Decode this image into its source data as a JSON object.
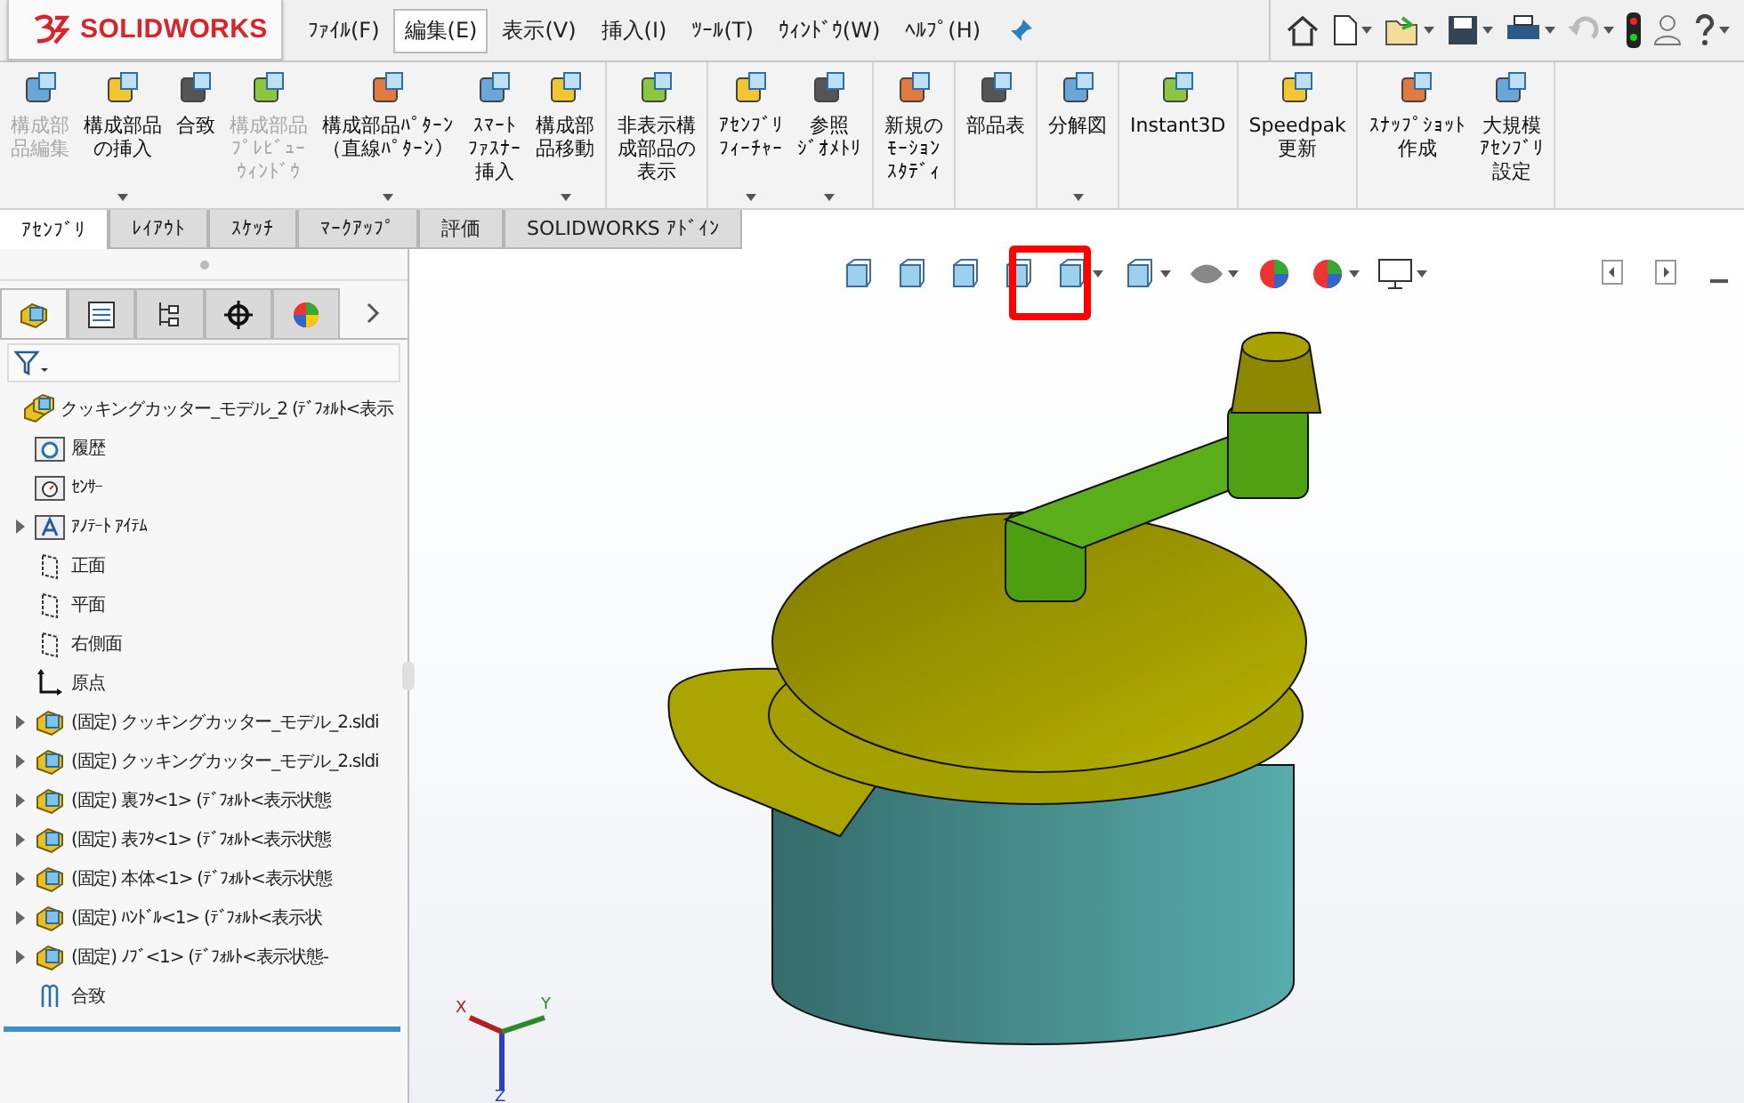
{
  "logo": {
    "text": "SOLIDWORKS"
  },
  "menu": [
    {
      "label": "ﾌｧｲﾙ(F)",
      "selected": false
    },
    {
      "label": "編集(E)",
      "selected": true
    },
    {
      "label": "表示(V)",
      "selected": false
    },
    {
      "label": "挿入(I)",
      "selected": false
    },
    {
      "label": "ﾂｰﾙ(T)",
      "selected": false
    },
    {
      "label": "ｳｨﾝﾄﾞｳ(W)",
      "selected": false
    },
    {
      "label": "ﾍﾙﾌﾟ(H)",
      "selected": false
    }
  ],
  "ribbon_groups": [
    [
      {
        "lines": [
          "構成部",
          "品編集"
        ],
        "disabled": true,
        "dropdown": false
      },
      {
        "lines": [
          "構成部品",
          "の挿入"
        ],
        "disabled": false,
        "dropdown": true
      },
      {
        "lines": [
          "合致"
        ],
        "disabled": false,
        "dropdown": false
      },
      {
        "lines": [
          "構成部品",
          "ﾌﾟﾚﾋﾞｭｰ",
          "ｳｨﾝﾄﾞｳ"
        ],
        "disabled": true,
        "dropdown": false
      },
      {
        "lines": [
          "構成部品ﾊﾟﾀｰﾝ",
          "（直線ﾊﾟﾀｰﾝ）"
        ],
        "disabled": false,
        "dropdown": true
      },
      {
        "lines": [
          "ｽﾏｰﾄ",
          "ﾌｧｽﾅｰ",
          "挿入"
        ],
        "disabled": false,
        "dropdown": false
      },
      {
        "lines": [
          "構成部",
          "品移動"
        ],
        "disabled": false,
        "dropdown": true
      }
    ],
    [
      {
        "lines": [
          "非表示構",
          "成部品の",
          "表示"
        ],
        "disabled": false,
        "dropdown": false
      }
    ],
    [
      {
        "lines": [
          "ｱｾﾝﾌﾞﾘ",
          "ﾌｨｰﾁｬｰ"
        ],
        "disabled": false,
        "dropdown": true
      },
      {
        "lines": [
          "参照",
          "ｼﾞｵﾒﾄﾘ"
        ],
        "disabled": false,
        "dropdown": true
      }
    ],
    [
      {
        "lines": [
          "新規の",
          "ﾓｰｼｮﾝ",
          "ｽﾀﾃﾞｨ"
        ],
        "disabled": false,
        "dropdown": false
      }
    ],
    [
      {
        "lines": [
          "部品表"
        ],
        "disabled": false,
        "dropdown": false
      }
    ],
    [
      {
        "lines": [
          "分解図"
        ],
        "disabled": false,
        "dropdown": true
      }
    ],
    [
      {
        "lines": [
          "Instant3D"
        ],
        "disabled": false,
        "dropdown": false
      }
    ],
    [
      {
        "lines": [
          "Speedpak",
          "更新"
        ],
        "disabled": false,
        "dropdown": false
      }
    ],
    [
      {
        "lines": [
          "ｽﾅｯﾌﾟｼｮｯﾄ",
          "作成"
        ],
        "disabled": false,
        "dropdown": false
      },
      {
        "lines": [
          "大規模",
          "ｱｾﾝﾌﾞﾘ",
          "設定"
        ],
        "disabled": false,
        "dropdown": false
      }
    ]
  ],
  "tabs": [
    {
      "label": "ｱｾﾝﾌﾞﾘ",
      "selected": true
    },
    {
      "label": "ﾚｲｱｳﾄ",
      "selected": false
    },
    {
      "label": "ｽｹｯﾁ",
      "selected": false
    },
    {
      "label": "ﾏｰｸｱｯﾌﾟ",
      "selected": false
    },
    {
      "label": "評価",
      "selected": false
    },
    {
      "label": "SOLIDWORKS ｱﾄﾞｲﾝ",
      "selected": false
    }
  ],
  "panel_tabs": [
    {
      "kind": "tree",
      "selected": true
    },
    {
      "kind": "property",
      "selected": false
    },
    {
      "kind": "config",
      "selected": false
    },
    {
      "kind": "dim",
      "selected": false
    },
    {
      "kind": "display",
      "selected": false
    }
  ],
  "tree": [
    {
      "kind": "assembly",
      "label": "クッキングカッター_モデル_2 (ﾃﾞﾌｫﾙﾄ<表示",
      "expandable": false,
      "children": [
        {
          "kind": "history",
          "label": "履歴",
          "expandable": false
        },
        {
          "kind": "sensor",
          "label": "ｾﾝｻｰ",
          "expandable": false
        },
        {
          "kind": "annotation",
          "label": "ｱﾉﾃｰﾄ ｱｲﾃﾑ",
          "expandable": true
        },
        {
          "kind": "plane",
          "label": "正面",
          "expandable": false
        },
        {
          "kind": "plane",
          "label": "平面",
          "expandable": false
        },
        {
          "kind": "plane",
          "label": "右側面",
          "expandable": false
        },
        {
          "kind": "origin",
          "label": "原点",
          "expandable": false
        },
        {
          "kind": "part",
          "label": "(固定) クッキングカッター_モデル_2.sldi",
          "expandable": true
        },
        {
          "kind": "part",
          "label": "(固定) クッキングカッター_モデル_2.sldi",
          "expandable": true
        },
        {
          "kind": "part",
          "label": "(固定) 裏ﾌﾀ<1> (ﾃﾞﾌｫﾙﾄ<表示状態",
          "expandable": true
        },
        {
          "kind": "part",
          "label": "(固定) 表ﾌﾀ<1> (ﾃﾞﾌｫﾙﾄ<表示状態",
          "expandable": true
        },
        {
          "kind": "part",
          "label": "(固定) 本体<1> (ﾃﾞﾌｫﾙﾄ<表示状態",
          "expandable": true
        },
        {
          "kind": "part",
          "label": "(固定) ﾊﾝﾄﾞﾙ<1> (ﾃﾞﾌｫﾙﾄ<表示状",
          "expandable": true
        },
        {
          "kind": "part",
          "label": "(固定) ﾉﾌﾞ<1> (ﾃﾞﾌｫﾙﾄ<表示状態-",
          "expandable": true
        },
        {
          "kind": "mate",
          "label": "合致",
          "expandable": false
        }
      ]
    }
  ],
  "triad": {
    "x": "X",
    "y": "Y",
    "z": "Z"
  }
}
